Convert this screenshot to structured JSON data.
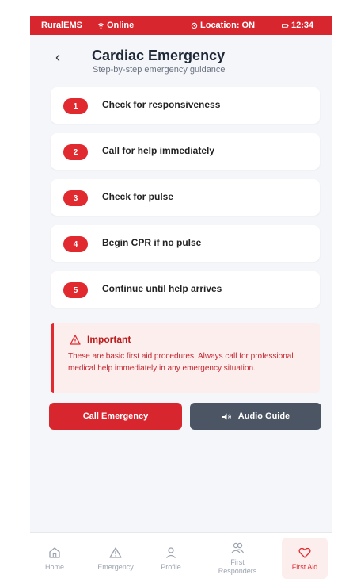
{
  "status_bar": {
    "app_name": "RuralEMS",
    "online": "Online",
    "location": "Location: ON",
    "time": "12:34"
  },
  "header": {
    "back": "‹",
    "title": "Cardiac Emergency",
    "subtitle": "Step-by-step emergency guidance"
  },
  "steps": [
    {
      "num": "1",
      "text": "Check for responsiveness"
    },
    {
      "num": "2",
      "text": "Call for help immediately"
    },
    {
      "num": "3",
      "text": "Check for pulse"
    },
    {
      "num": "4",
      "text": "Begin CPR if no pulse"
    },
    {
      "num": "5",
      "text": "Continue until help arrives"
    }
  ],
  "important": {
    "title": "Important",
    "text": "These are basic first aid procedures. Always call for professional medical help immediately in any emergency situation."
  },
  "buttons": {
    "call": "Call Emergency",
    "audio": "Audio Guide"
  },
  "nav": {
    "home": "Home",
    "emergency": "Emergency",
    "profile": "Profile",
    "first_responders": "First Responders",
    "first_aid": "First Aid"
  },
  "colors": {
    "accent": "#d8262f",
    "dark_button": "#4b5563",
    "alert_bg": "#fdeeee"
  },
  "icons": {
    "online": "wifi-icon",
    "location": "location-pin-icon",
    "time": "battery-icon",
    "back": "chevron-left-icon",
    "important": "warning-triangle-icon",
    "audio": "speaker-icon",
    "home": "home-icon",
    "emergency": "alert-triangle-icon",
    "profile": "user-icon",
    "first_responders": "users-icon",
    "first_aid": "heart-icon"
  }
}
